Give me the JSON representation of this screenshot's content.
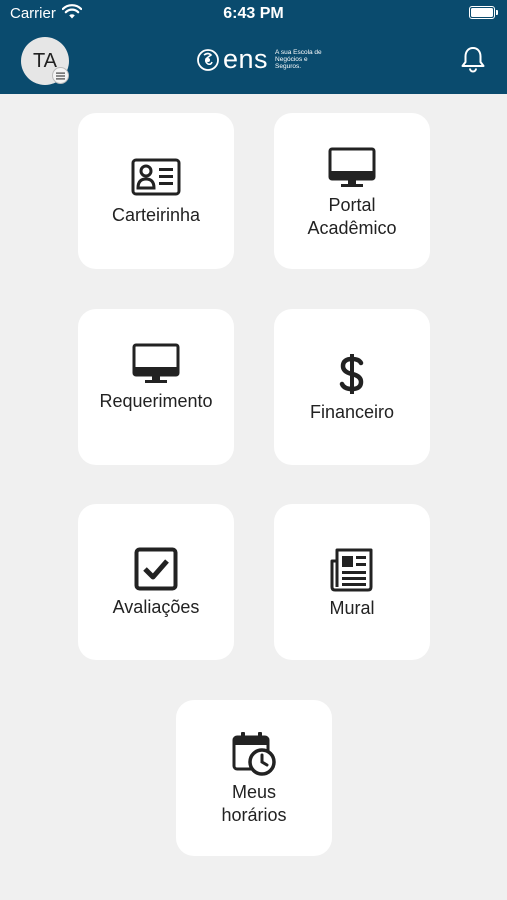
{
  "status_bar": {
    "carrier": "Carrier",
    "time": "6:43 PM"
  },
  "header": {
    "avatar_initials": "TA",
    "logo_text": "ens",
    "tagline": "A sua Escola de Negócios e Seguros.",
    "accent_color": "#0a4b6e"
  },
  "menu": {
    "tiles": [
      {
        "label": "Carteirinha",
        "icon": "id-card-icon"
      },
      {
        "label": "Portal Acadêmico",
        "icon": "monitor-icon"
      },
      {
        "label": "Requerimento",
        "icon": "monitor-icon"
      },
      {
        "label": "Financeiro",
        "icon": "dollar-icon"
      },
      {
        "label": "Avaliações",
        "icon": "checkbox-icon"
      },
      {
        "label": "Mural",
        "icon": "newspaper-icon"
      },
      {
        "label": "Meus horários",
        "icon": "calendar-clock-icon"
      }
    ]
  }
}
